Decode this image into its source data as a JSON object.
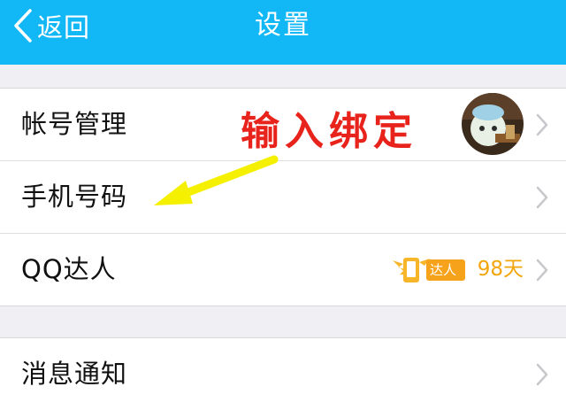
{
  "nav": {
    "back_label": "返回",
    "title": "设置",
    "color": "#12b7f5"
  },
  "rows": [
    {
      "label": "帐号管理"
    },
    {
      "label": "手机号码"
    },
    {
      "label": "QQ达人",
      "badge_label": "达人",
      "days": "98天"
    },
    {
      "label": "消息通知"
    }
  ],
  "annotation": {
    "text": "输入绑定",
    "color": "#e8231c",
    "arrow_color": "#f4f000"
  },
  "icons": [
    "chevron-left-icon",
    "chevron-right-icon",
    "avatar",
    "qq-expert-badge-icon"
  ]
}
